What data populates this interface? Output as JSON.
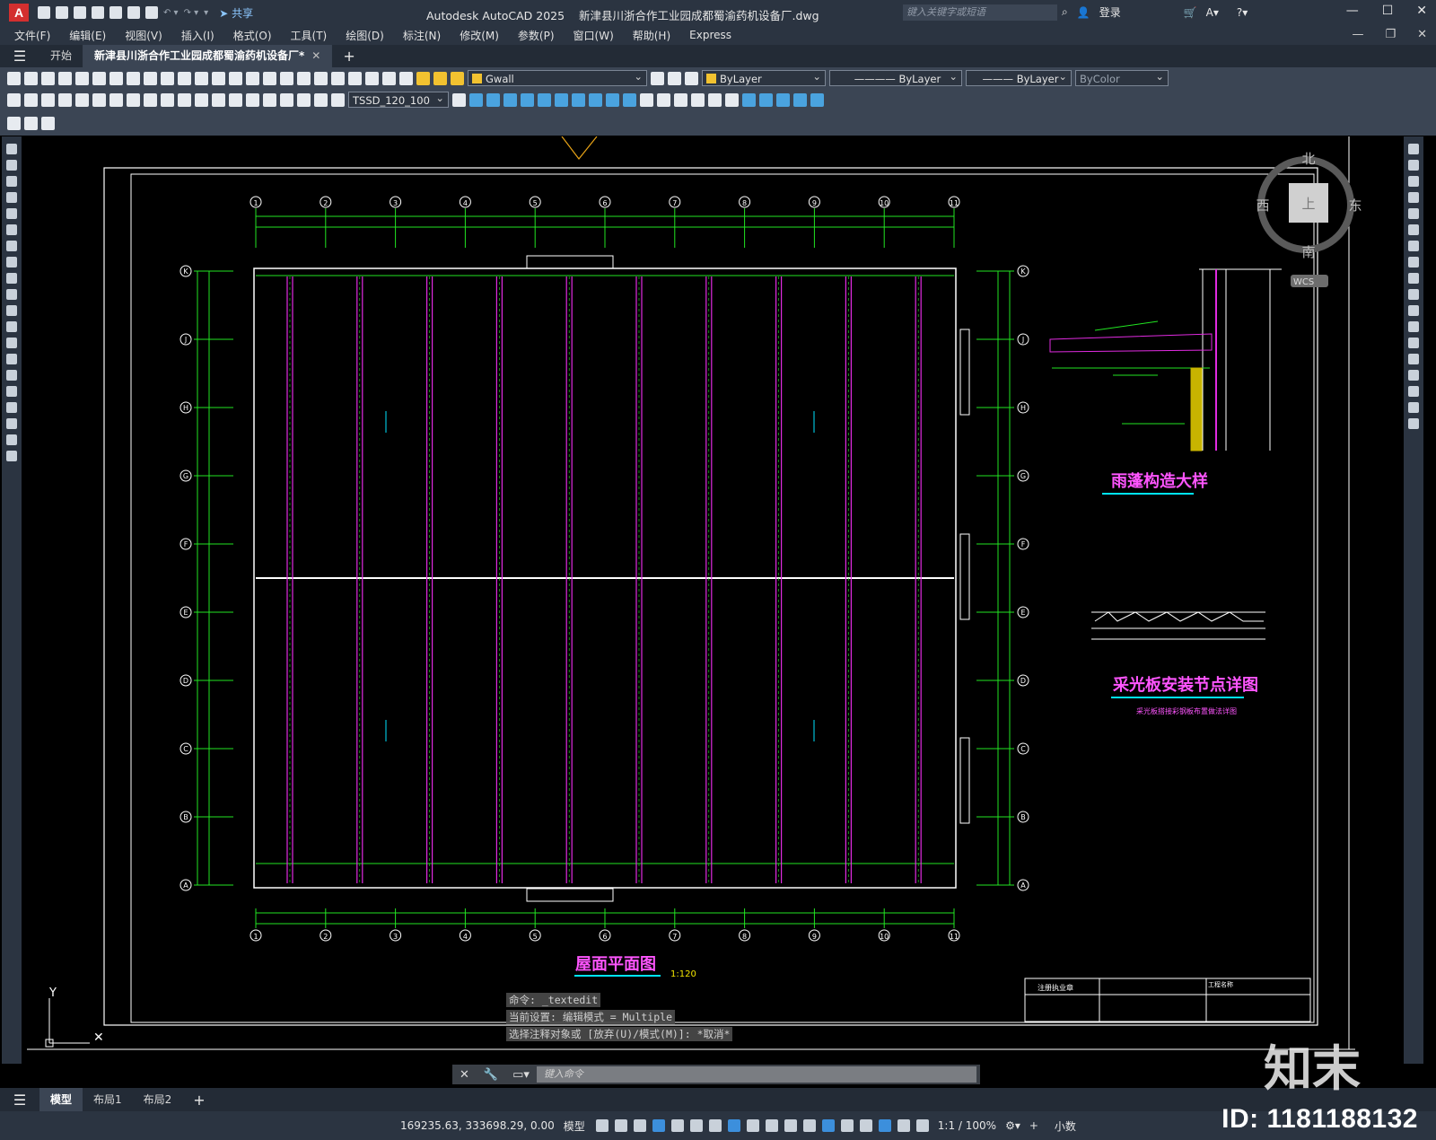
{
  "app": {
    "logo": "A",
    "title": "Autodesk AutoCAD 2025",
    "filename": "新津县川浙合作工业园成都蜀渝药机设备厂.dwg",
    "share_label": "共享",
    "search_placeholder": "键入关键字或短语",
    "login_label": "登录"
  },
  "menu": [
    "文件(F)",
    "编辑(E)",
    "视图(V)",
    "插入(I)",
    "格式(O)",
    "工具(T)",
    "绘图(D)",
    "标注(N)",
    "修改(M)",
    "参数(P)",
    "窗口(W)",
    "帮助(H)",
    "Express"
  ],
  "tabs": {
    "start": "开始",
    "active": "新津县川浙合作工业园成都蜀渝药机设备厂*"
  },
  "toolbar": {
    "layer": "Gwall",
    "color": "ByLayer",
    "linetype": "ByLayer",
    "lineweight": "ByLayer",
    "plotstyle": "ByColor",
    "dimstyle": "TSSD_120_100",
    "accent_layer": "#f2c230",
    "accent_color": "#f2c230"
  },
  "drawing": {
    "grid_x_labels": [
      "1",
      "2",
      "3",
      "4",
      "5",
      "6",
      "7",
      "8",
      "9",
      "10",
      "11"
    ],
    "grid_y_labels": [
      "K",
      "J",
      "H",
      "G",
      "F",
      "E",
      "D",
      "C",
      "B",
      "A"
    ],
    "plan_title": "屋面平面图",
    "plan_scale": "1:120",
    "detail1_title": "雨蓬构造大样",
    "detail2_title": "采光板安装节点详图",
    "detail2_note": "采光板搭接彩钢板布置做法详图",
    "viewcube": {
      "north": "北",
      "south": "南",
      "east": "东",
      "west": "西",
      "top": "上",
      "wcs": "WCS"
    },
    "ucs": {
      "y": "Y"
    },
    "title_block": {
      "row1": "注册执业章",
      "project": "工程名称"
    },
    "colors": {
      "grid": "#22e522",
      "purlin": "#e12be1",
      "title": "#ff55ff",
      "underline": "#00e5ff"
    }
  },
  "command": {
    "history": [
      "命令: _textedit",
      "当前设置: 编辑模式 = Multiple",
      "选择注释对象或 [放弃(U)/模式(M)]: *取消*"
    ],
    "placeholder": "键入命令"
  },
  "layouts": [
    "模型",
    "布局1",
    "布局2"
  ],
  "status": {
    "coords": "169235.63, 333698.29, 0.00",
    "space": "模型",
    "scale": "1:1 / 100%",
    "units": "小数"
  },
  "watermark": {
    "id": "ID: 1181188132",
    "brand": "知末"
  }
}
